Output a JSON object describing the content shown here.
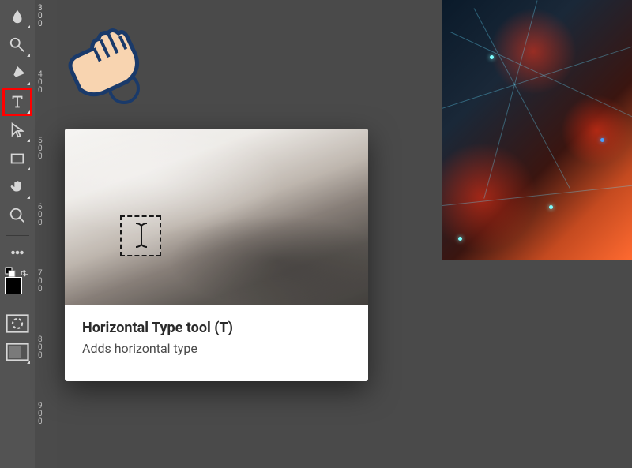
{
  "tools": {
    "blur": "blur-tool",
    "dodge": "dodge-tool",
    "pen": "pen-tool",
    "type": "type-tool",
    "path": "path-selection-tool",
    "rectangle": "rectangle-tool",
    "hand": "hand-tool",
    "zoom": "zoom-tool"
  },
  "tooltip": {
    "title": "Horizontal Type tool (T)",
    "description": "Adds horizontal type"
  },
  "ruler": {
    "marks": [
      "300",
      "400",
      "500",
      "600",
      "700",
      "800",
      "900"
    ]
  }
}
